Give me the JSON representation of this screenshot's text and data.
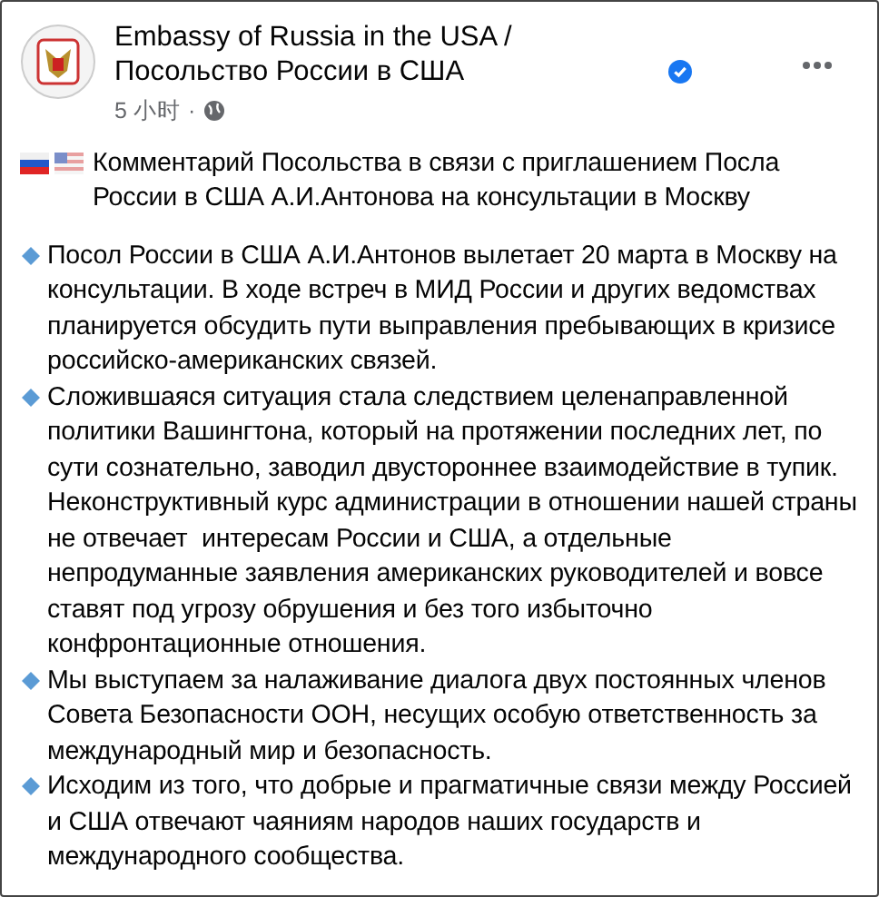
{
  "post": {
    "author": "Embassy of Russia in the USA / Посольство России в США",
    "verified": true,
    "time": "5 小时",
    "separator": "·",
    "headline": "Комментарий Посольства в связи с приглашением Посла России в США А.И.Антонова на консультации в Москву",
    "paragraphs": [
      {
        "text": "Посол России в США А.И.Антонов вылетает 20 марта в Москву на консультации. В ходе встреч в МИД России и других ведомствах планируется обсудить пути выправления пребывающих в кризисе российско-американских связей."
      },
      {
        "text": "Сложившаяся ситуация стала следствием целенаправленной политики Вашингтона, который на протяжении последних лет, по сути сознательно, заводил двустороннее взаимодействие в тупик. Неконструктивный курс администрации в отношении нашей страны не отвечает  интересам России и США, а отдельные непродуманные заявления американских руководителей и вовсе ставят под угрозу обрушения и без того избыточно конфронтационные отношения."
      },
      {
        "text": "Мы выступаем за налаживание диалога двух постоянных членов Совета Безопасности ООН, несущих особую ответственность за международный мир и безопасность."
      },
      {
        "text": "Исходим из того, что добрые и прагматичные связи между Россией и США отвечают чаяниям народов наших государств и международного сообщества."
      }
    ]
  }
}
